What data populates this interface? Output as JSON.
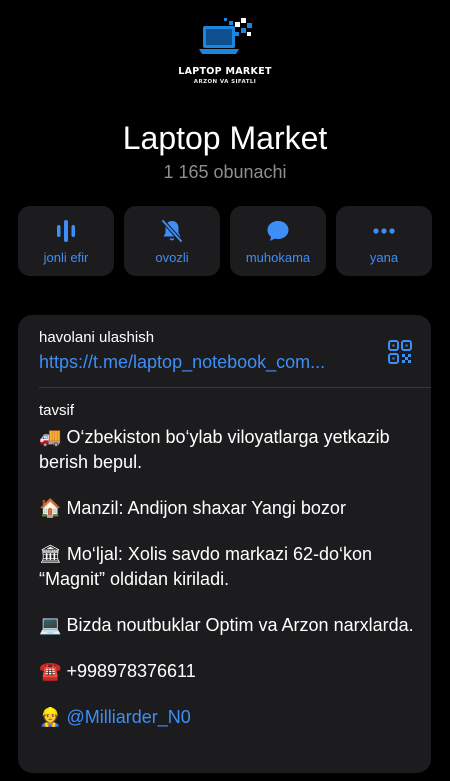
{
  "logo": {
    "title": "LAPTOP MARKET",
    "subtitle": "ARZON VA SIFATLI",
    "icon": "laptop-icon",
    "accent": "#1b86e0"
  },
  "channel": {
    "title": "Laptop Market",
    "subscribers": "1 165 obunachi"
  },
  "actions": [
    {
      "label": "jonli efir",
      "icon": "live-stream-icon"
    },
    {
      "label": "ovozli",
      "icon": "bell-muted-icon"
    },
    {
      "label": "muhokama",
      "icon": "chat-bubble-icon"
    },
    {
      "label": "yana",
      "icon": "more-dots-icon"
    }
  ],
  "share": {
    "caption": "havolani ulashish",
    "link": "https://t.me/laptop_notebook_com...",
    "qr_icon": "qr-code-icon"
  },
  "description": {
    "caption": "tavsif",
    "paragraphs": [
      {
        "emoji": "🚚",
        "text": "O‘zbekiston bo‘ylab viloyatlarga yetkazib berish bepul."
      },
      {
        "emoji": "🏠",
        "text": "Manzil: Andijon shaxar Yangi bozor"
      },
      {
        "emoji": "🏛",
        "text": "Mo‘ljal: Xolis savdo markazi 62-do‘kon “Magnit” oldidan kiriladi."
      },
      {
        "emoji": "💻",
        "text": "Bizda noutbuklar Optim va Arzon narxlarda."
      },
      {
        "emoji": "☎️",
        "text": "+998978376611"
      },
      {
        "emoji": "👷",
        "text": "@Milliarder_N0"
      }
    ]
  },
  "colors": {
    "background": "#000000",
    "card": "#1c1c1e",
    "accent": "#3e8ef7",
    "secondary_text": "#8d8d93"
  }
}
